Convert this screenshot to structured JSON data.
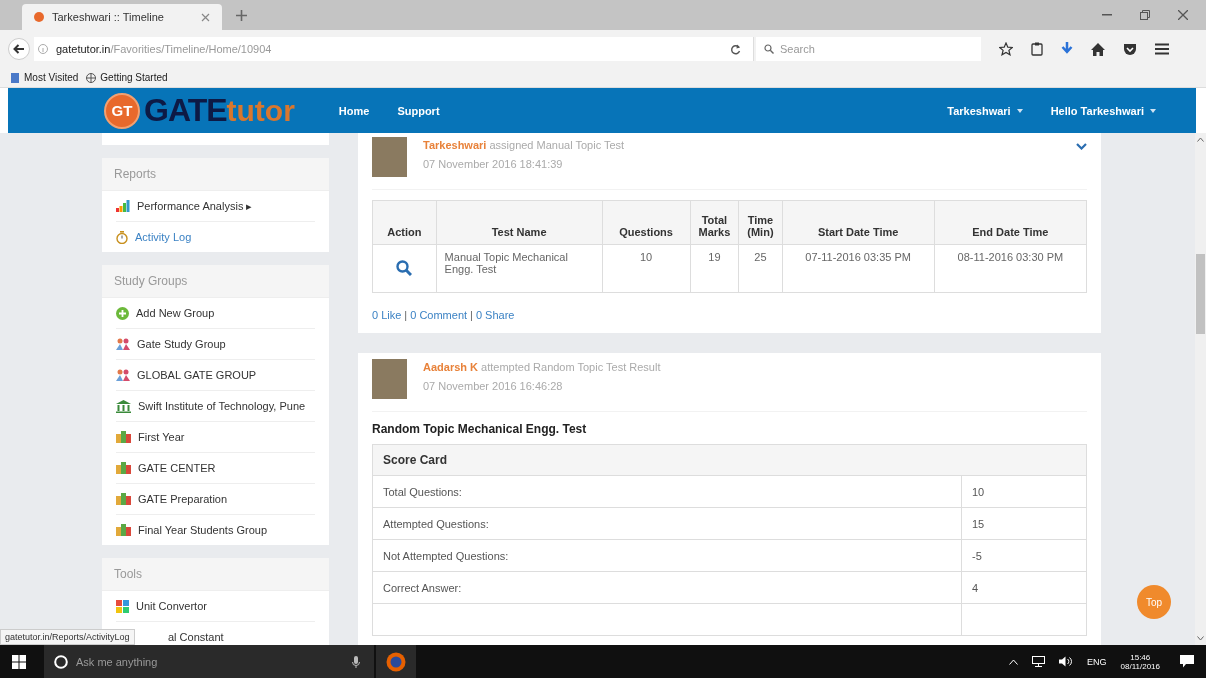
{
  "browser": {
    "tab_title": "Tarkeshwari :: Timeline",
    "url_host": "gatetutor.in",
    "url_path": "/Favorities/Timeline/Home/10904",
    "search_placeholder": "Search",
    "bookmarks": [
      "Most Visited",
      "Getting Started"
    ]
  },
  "site": {
    "logo_badge": "GT",
    "logo_word": "GATE",
    "logo_suffix": "tutor",
    "nav": [
      "Home",
      "Support"
    ],
    "user_menus": [
      "Tarkeshwari",
      "Hello Tarkeshwari"
    ]
  },
  "sidebar": [
    {
      "title": "Reports",
      "items": [
        {
          "label": "Performance Analysis ▸",
          "kind": "chart",
          "hovered": false
        },
        {
          "label": "Activity Log",
          "kind": "stopwatch",
          "hovered": true
        }
      ]
    },
    {
      "title": "Study Groups",
      "items": [
        {
          "label": "Add New Group",
          "kind": "add",
          "hovered": false
        },
        {
          "label": "Gate Study Group",
          "kind": "people",
          "hovered": false
        },
        {
          "label": "GLOBAL GATE GROUP",
          "kind": "people",
          "hovered": false
        },
        {
          "label": "Swift Institute of Technology, Pune",
          "kind": "institute",
          "hovered": false
        },
        {
          "label": "First Year",
          "kind": "group",
          "hovered": false
        },
        {
          "label": "GATE CENTER",
          "kind": "group",
          "hovered": false
        },
        {
          "label": "GATE Preparation",
          "kind": "group",
          "hovered": false
        },
        {
          "label": "Final Year Students Group",
          "kind": "group",
          "hovered": false
        }
      ]
    },
    {
      "title": "Tools",
      "items": [
        {
          "label": "Unit Convertor",
          "kind": "tool",
          "hovered": false
        },
        {
          "label": "al Constant",
          "kind": "hidden",
          "hovered": false
        }
      ]
    }
  ],
  "posts": [
    {
      "kind": "assignment",
      "author": "Tarkeshwari",
      "action": "assigned Manual Topic Test",
      "time": "07 November 2016 18:41:39",
      "columns": [
        "Action",
        "Test Name",
        "Questions",
        "Total Marks",
        "Time (Min)",
        "Start Date Time",
        "End Date Time"
      ],
      "row": [
        "Manual Topic Mechanical Engg. Test",
        "10",
        "19",
        "25",
        "07-11-2016 03:35 PM",
        "08-11-2016 03:30 PM"
      ],
      "links": [
        "0 Like",
        "0 Comment",
        "0 Share"
      ],
      "separator": "|"
    },
    {
      "kind": "result",
      "author": "Aadarsh K",
      "action": "attempted Random Topic Test Result",
      "time": "07 November 2016 16:46:28",
      "title": "Random Topic Mechanical Engg. Test",
      "score_heading": "Score Card",
      "scores": [
        {
          "label": "Total Questions:",
          "value": "10"
        },
        {
          "label": "Attempted Questions:",
          "value": "15"
        },
        {
          "label": "Not Attempted Questions:",
          "value": "-5"
        },
        {
          "label": "Correct Answer:",
          "value": "4"
        }
      ]
    }
  ],
  "top_button": "Top",
  "status_tooltip": "gatetutor.in/Reports/ActivityLog",
  "taskbar": {
    "search_placeholder": "Ask me anything",
    "language": "ENG",
    "time": "15:46",
    "date": "08/11/2016"
  }
}
